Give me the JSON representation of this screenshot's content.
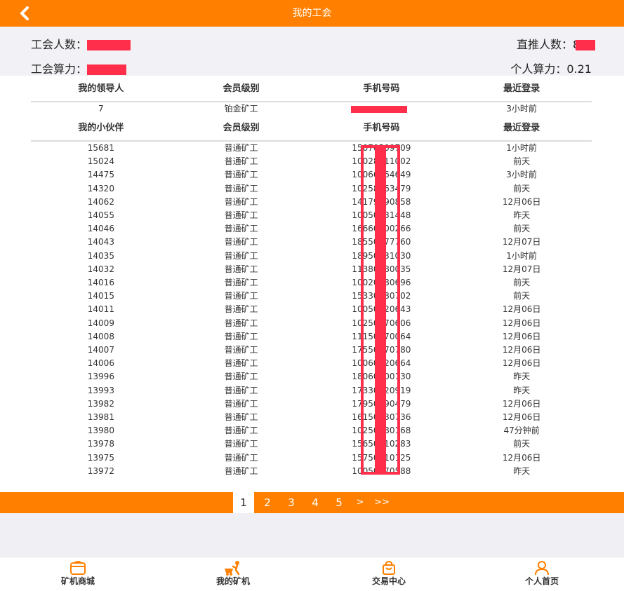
{
  "header": {
    "title": "我的工会"
  },
  "stats": {
    "member_count_label": "工会人数：",
    "direct_count_label": "直推人数：",
    "direct_count_prefix": "8",
    "power_label": "工会算力：",
    "personal_power": "个人算力：0.21"
  },
  "leader_table": {
    "headers": [
      "我的领导人",
      "会员级别",
      "手机号码",
      "最近登录"
    ],
    "row": {
      "id": "7",
      "level": "铂金矿工",
      "last_login": "3小时前"
    }
  },
  "partner_table": {
    "headers": [
      "我的小伙伴",
      "会员级别",
      "手机号码",
      "最近登录"
    ],
    "rows": [
      {
        "id": "15681",
        "level": "普通矿工",
        "phone": "15070509709",
        "last_login": "1小时前"
      },
      {
        "id": "15024",
        "level": "普通矿工",
        "phone": "10028311002",
        "last_login": "前天"
      },
      {
        "id": "14475",
        "level": "普通矿工",
        "phone": "10066664649",
        "last_login": "3小时前"
      },
      {
        "id": "14320",
        "level": "普通矿工",
        "phone": "10258463479",
        "last_login": "前天"
      },
      {
        "id": "14062",
        "level": "普通矿工",
        "phone": "14179790858",
        "last_login": "12月06日"
      },
      {
        "id": "14055",
        "level": "普通矿工",
        "phone": "10050431448",
        "last_login": "昨天"
      },
      {
        "id": "14046",
        "level": "普通矿工",
        "phone": "16660100266",
        "last_login": "前天"
      },
      {
        "id": "14043",
        "level": "普通矿工",
        "phone": "18550177760",
        "last_login": "12月07日"
      },
      {
        "id": "14035",
        "level": "普通矿工",
        "phone": "18950731030",
        "last_login": "1小时前"
      },
      {
        "id": "14032",
        "level": "普通矿工",
        "phone": "11380580035",
        "last_login": "12月07日"
      },
      {
        "id": "14016",
        "level": "普通矿工",
        "phone": "10020080696",
        "last_login": "前天"
      },
      {
        "id": "14015",
        "level": "普通矿工",
        "phone": "15330180702",
        "last_login": "前天"
      },
      {
        "id": "14011",
        "level": "普通矿工",
        "phone": "10050320643",
        "last_login": "12月06日"
      },
      {
        "id": "14009",
        "level": "普通矿工",
        "phone": "10250770606",
        "last_login": "12月06日"
      },
      {
        "id": "14008",
        "level": "普通矿工",
        "phone": "11150770064",
        "last_login": "12月06日"
      },
      {
        "id": "14007",
        "level": "普通矿工",
        "phone": "17550770780",
        "last_login": "12月06日"
      },
      {
        "id": "14006",
        "level": "普通矿工",
        "phone": "10060620664",
        "last_login": "12月06日"
      },
      {
        "id": "13996",
        "level": "普通矿工",
        "phone": "18060300130",
        "last_login": "昨天"
      },
      {
        "id": "13993",
        "level": "普通矿工",
        "phone": "17330520919",
        "last_login": "昨天"
      },
      {
        "id": "13982",
        "level": "普通矿工",
        "phone": "17950190479",
        "last_login": "12月06日"
      },
      {
        "id": "13981",
        "level": "普通矿工",
        "phone": "16150130736",
        "last_login": "12月06日"
      },
      {
        "id": "13980",
        "level": "普通矿工",
        "phone": "10250780168",
        "last_login": "47分钟前"
      },
      {
        "id": "13978",
        "level": "普通矿工",
        "phone": "15650110283",
        "last_login": "前天"
      },
      {
        "id": "13975",
        "level": "普通矿工",
        "phone": "15750310125",
        "last_login": "12月06日"
      },
      {
        "id": "13972",
        "level": "普通矿工",
        "phone": "10050770588",
        "last_login": "昨天"
      }
    ]
  },
  "pagination": {
    "pages": [
      "1",
      "2",
      "3",
      "4",
      "5",
      ">",
      ">>"
    ],
    "active": "1"
  },
  "bottom_nav": [
    {
      "label": "矿机商城",
      "icon": "shop-icon"
    },
    {
      "label": "我的矿机",
      "icon": "miner-icon"
    },
    {
      "label": "交易中心",
      "icon": "bag-icon"
    },
    {
      "label": "个人首页",
      "icon": "person-icon"
    }
  ],
  "colors": {
    "brand": "#ff8000",
    "mask_red": "#ff2e4a"
  }
}
